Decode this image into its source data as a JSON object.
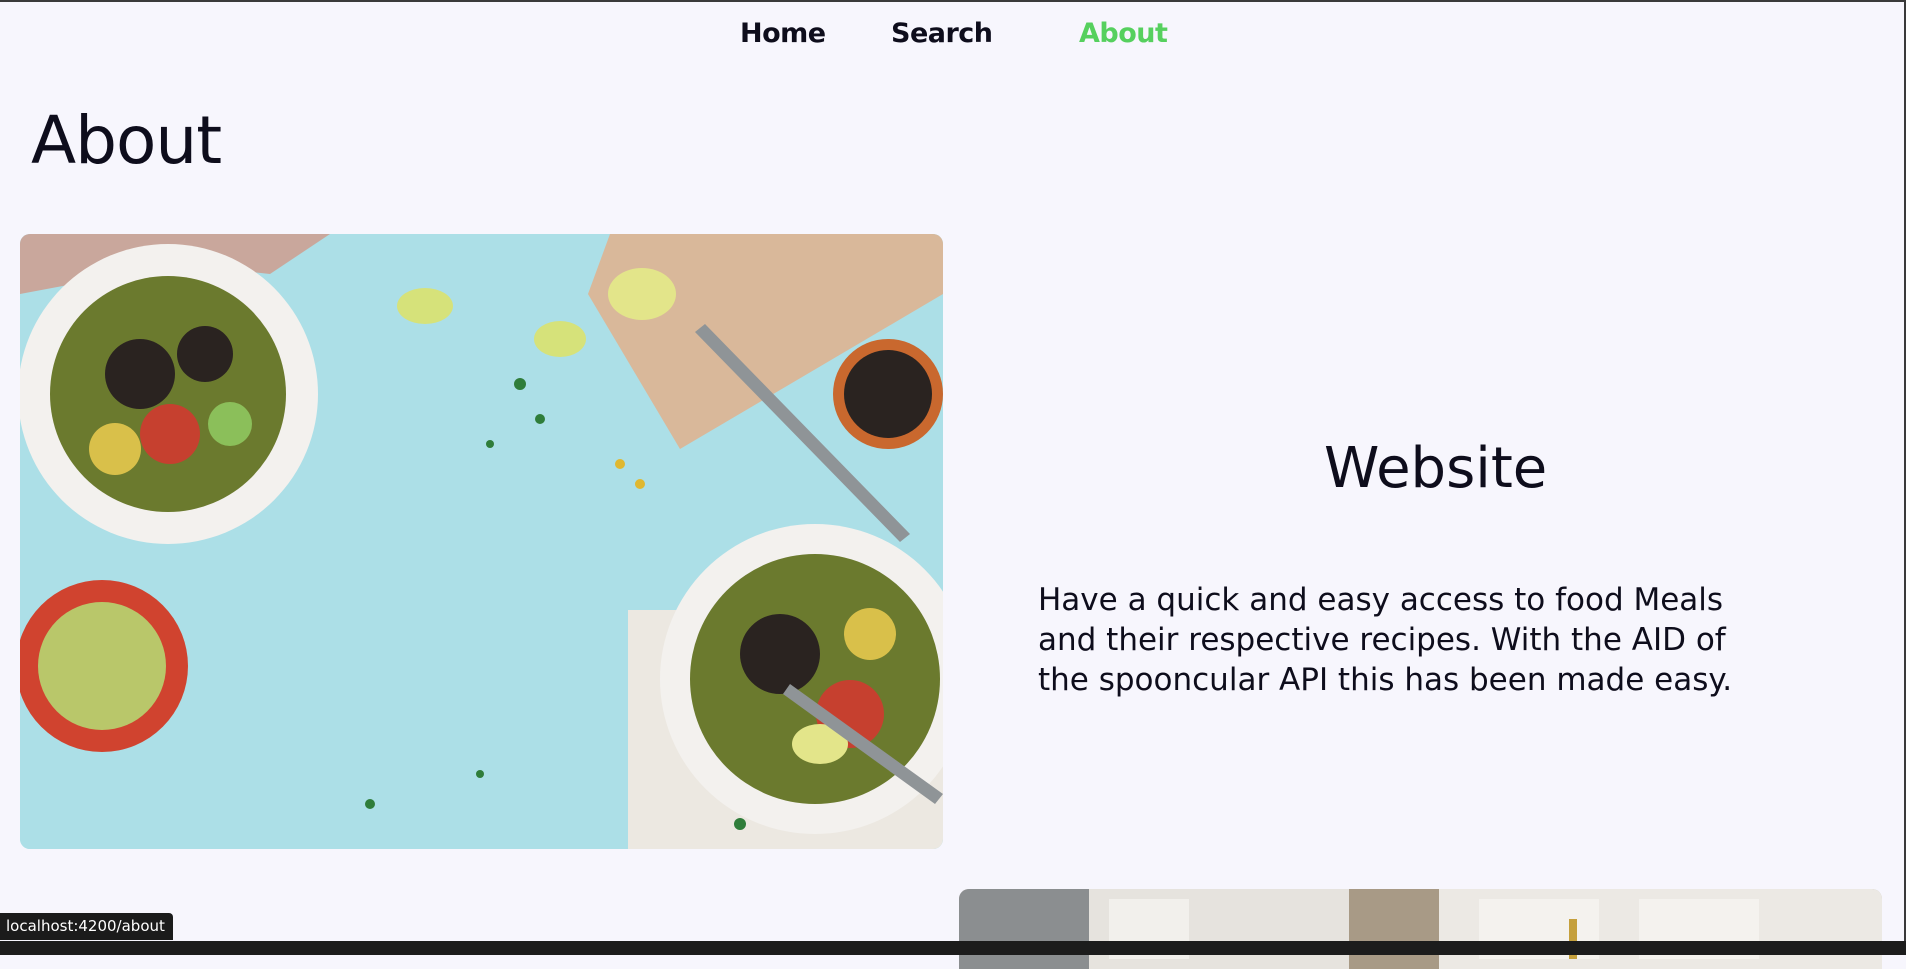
{
  "nav": {
    "home": "Home",
    "search": "Search",
    "about": "About",
    "active_color": "#56d05e"
  },
  "page": {
    "title": "About"
  },
  "website": {
    "heading": "Website",
    "description": "Have a quick and easy access to food Meals and their respective recipes. With the AID of the spooncular API this has been made easy."
  },
  "status_bar": {
    "url": "localhost:4200/about"
  },
  "images": {
    "hero": "salad-bowls-photo",
    "second": "kitchen-photo"
  }
}
